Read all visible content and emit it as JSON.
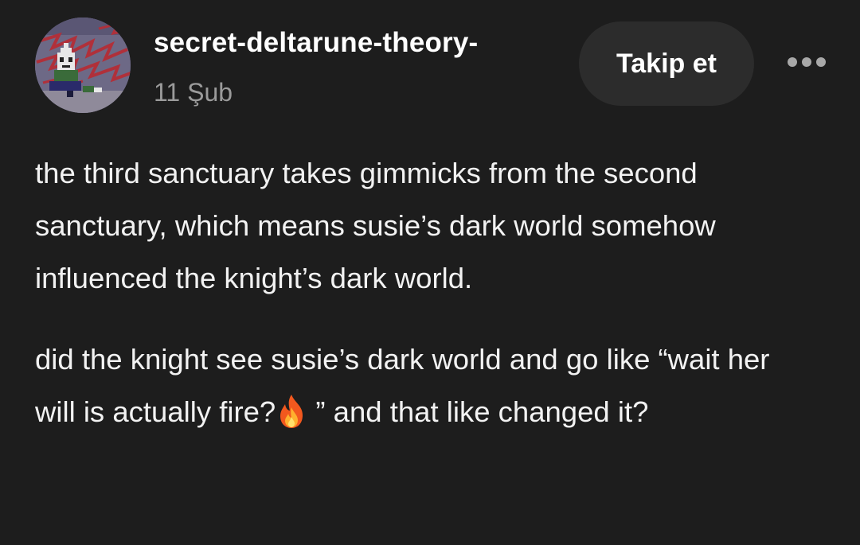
{
  "post": {
    "author": {
      "username": "secret-deltarune-theory-",
      "avatar_icon": "pixel-character-avatar"
    },
    "date": "11 Şub",
    "follow_label": "Takip et",
    "more_icon": "more-dots-icon",
    "paragraph1": "the third sanctuary takes gimmicks from the second sanctuary, which means susie’s dark world somehow influenced the knight’s dark world.",
    "paragraph2_before": "did the knight see susie’s dark world and go like “wait her will is actually fire?",
    "paragraph2_emoji": "fire-icon",
    "paragraph2_after": " ” and that like changed it?"
  },
  "colors": {
    "background": "#1d1d1d",
    "text": "#f2f2f2",
    "muted": "#9b9b9b",
    "button_bg": "#2c2c2c"
  }
}
